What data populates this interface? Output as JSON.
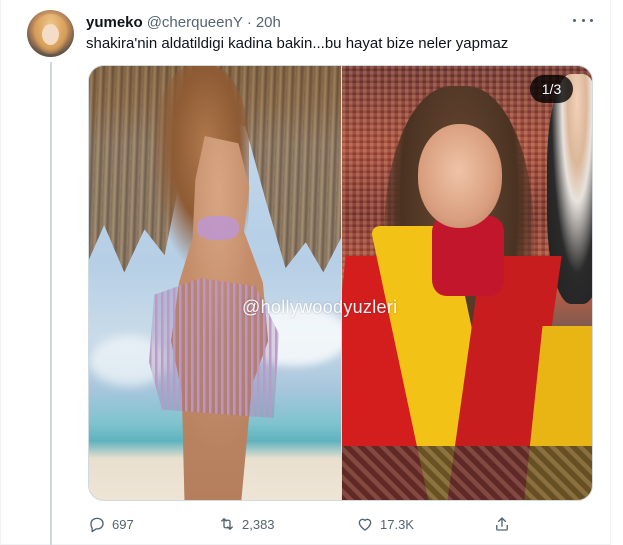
{
  "tweet": {
    "display_name": "yumeko",
    "handle": "@cherqueenY",
    "separator": "·",
    "time": "20h",
    "text": "shakira'nin aldatildigi kadina bakin...bu hayat bize neler yapmaz"
  },
  "media": {
    "counter": "1/3",
    "watermark": "@hollywoodyuzleri"
  },
  "actions": {
    "reply_count": "697",
    "retweet_count": "2,383",
    "like_count": "17.3K",
    "reply_icon": "reply-icon",
    "retweet_icon": "retweet-icon",
    "like_icon": "heart-icon",
    "share_icon": "share-icon"
  },
  "colors": {
    "text_primary": "#0f1419",
    "text_secondary": "#536471",
    "border": "#cfd9de"
  }
}
